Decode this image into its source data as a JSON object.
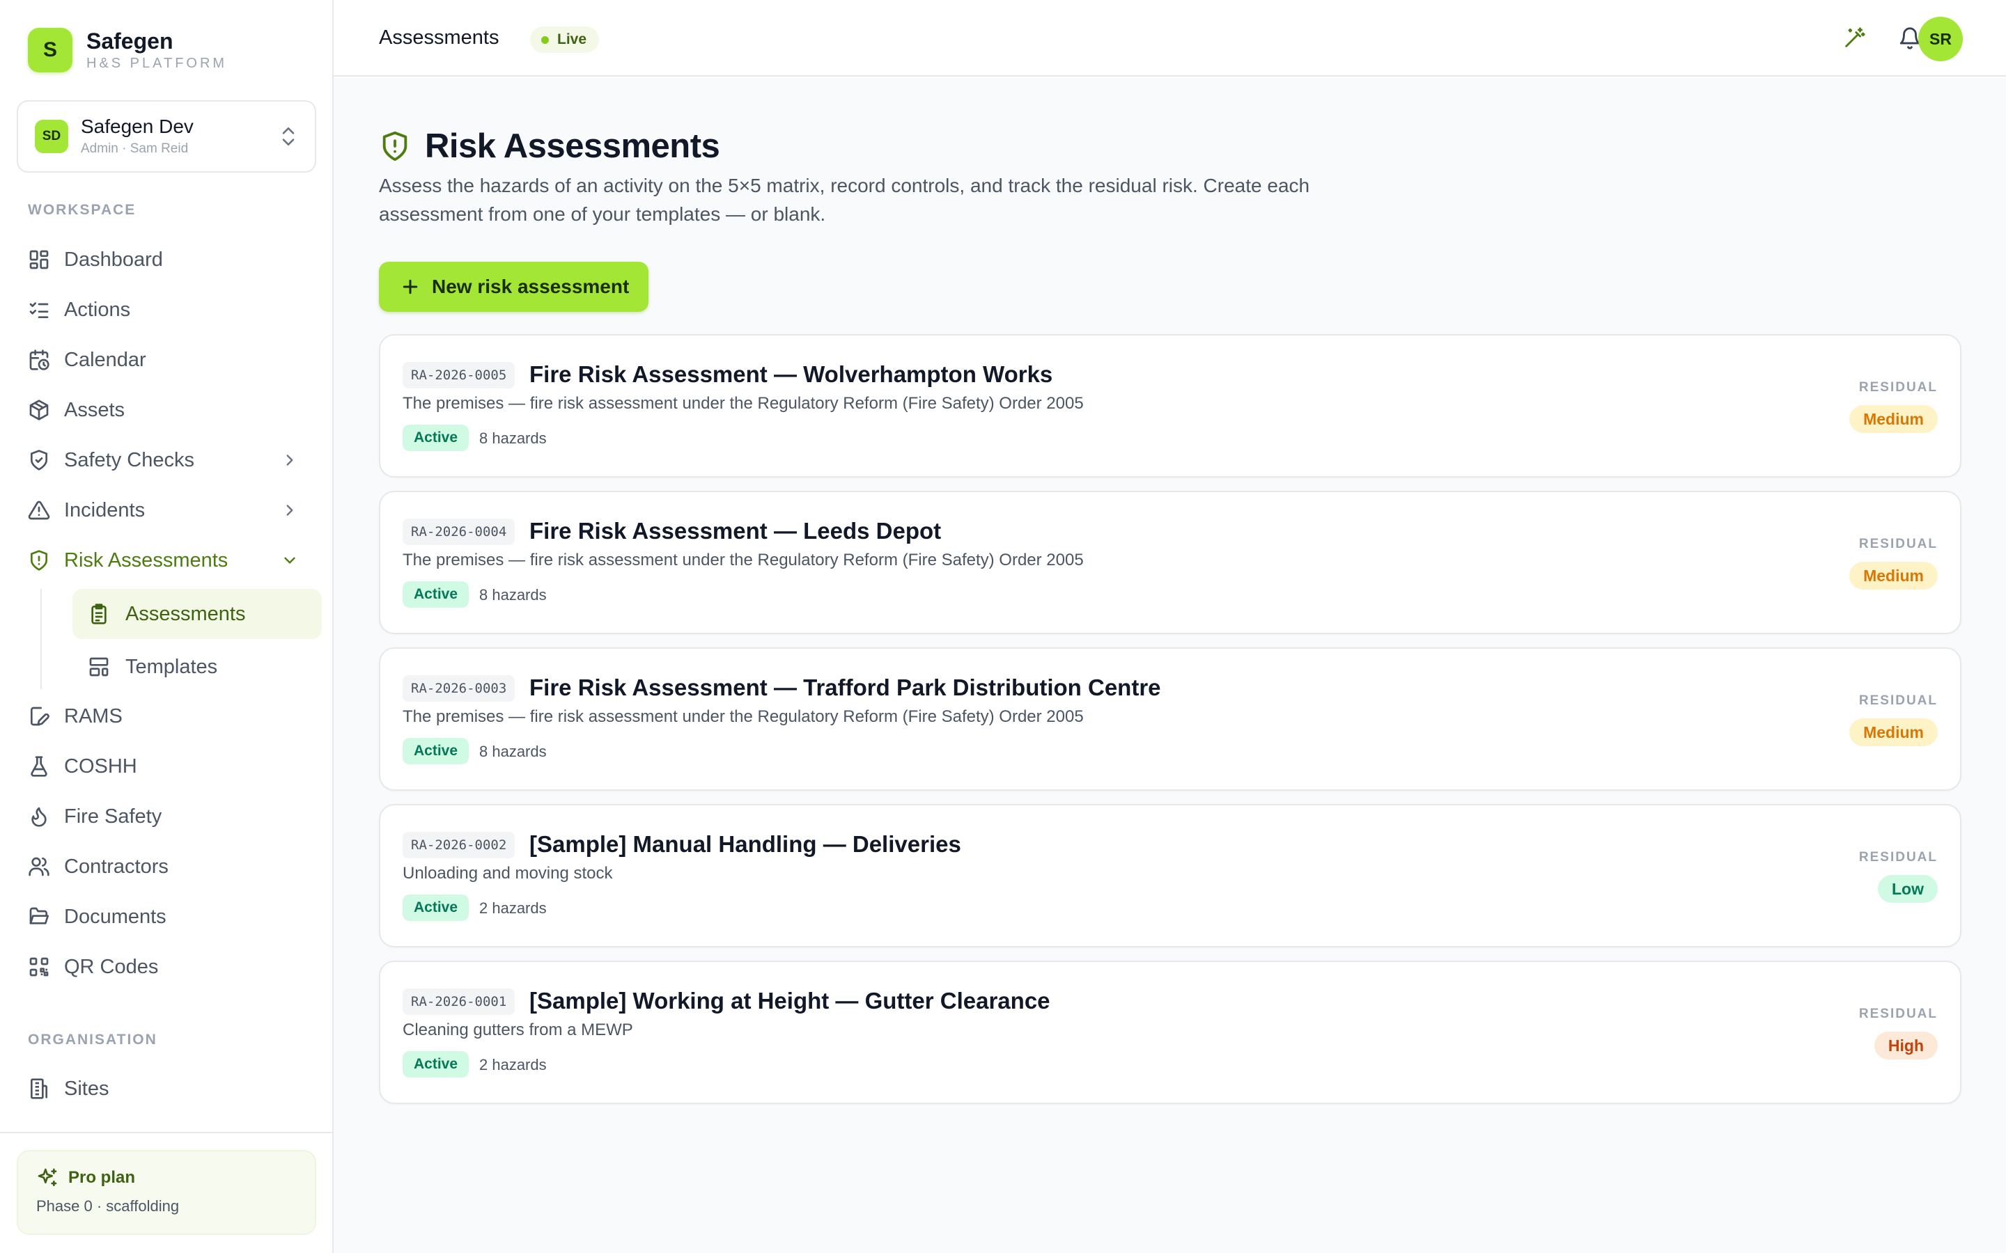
{
  "brand": {
    "logo_letter": "S",
    "name": "Safegen",
    "subtitle": "H&S PLATFORM"
  },
  "org": {
    "initials": "SD",
    "name": "Safegen Dev",
    "meta": "Admin · Sam Reid"
  },
  "sidebar": {
    "workspace_label": "WORKSPACE",
    "organisation_label": "ORGANISATION",
    "items": [
      {
        "label": "Dashboard",
        "icon": "dashboard-icon"
      },
      {
        "label": "Actions",
        "icon": "list-checks-icon"
      },
      {
        "label": "Calendar",
        "icon": "calendar-clock-icon"
      },
      {
        "label": "Assets",
        "icon": "package-icon"
      },
      {
        "label": "Safety Checks",
        "icon": "shield-check-icon"
      },
      {
        "label": "Incidents",
        "icon": "alert-triangle-icon"
      },
      {
        "label": "Risk Assessments",
        "icon": "shield-alert-icon"
      },
      {
        "label": "RAMS",
        "icon": "file-edit-icon"
      },
      {
        "label": "COSHH",
        "icon": "flask-icon"
      },
      {
        "label": "Fire Safety",
        "icon": "flame-icon"
      },
      {
        "label": "Contractors",
        "icon": "users-icon"
      },
      {
        "label": "Documents",
        "icon": "folder-open-icon"
      },
      {
        "label": "QR Codes",
        "icon": "qr-code-icon"
      }
    ],
    "sub_items": [
      {
        "label": "Assessments",
        "icon": "clipboard-list-icon"
      },
      {
        "label": "Templates",
        "icon": "layout-template-icon"
      }
    ],
    "org_items": [
      {
        "label": "Sites",
        "icon": "building-icon"
      }
    ],
    "plan": {
      "title": "Pro plan",
      "subtitle": "Phase 0 · scaffolding"
    }
  },
  "topbar": {
    "title": "Assessments",
    "live_label": "Live",
    "user_initials": "SR"
  },
  "page": {
    "title": "Risk Assessments",
    "description": "Assess the hazards of an activity on the 5×5 matrix, record controls, and track the residual risk. Create each assessment from one of your templates — or blank.",
    "new_button": "New risk assessment",
    "residual_label": "RESIDUAL"
  },
  "assessments": [
    {
      "id": "RA-2026-0005",
      "title": "Fire Risk Assessment — Wolverhampton Works",
      "description": "The premises — fire risk assessment under the Regulatory Reform (Fire Safety) Order 2005",
      "status": "Active",
      "hazards": "8 hazards",
      "residual": "Medium"
    },
    {
      "id": "RA-2026-0004",
      "title": "Fire Risk Assessment — Leeds Depot",
      "description": "The premises — fire risk assessment under the Regulatory Reform (Fire Safety) Order 2005",
      "status": "Active",
      "hazards": "8 hazards",
      "residual": "Medium"
    },
    {
      "id": "RA-2026-0003",
      "title": "Fire Risk Assessment — Trafford Park Distribution Centre",
      "description": "The premises — fire risk assessment under the Regulatory Reform (Fire Safety) Order 2005",
      "status": "Active",
      "hazards": "8 hazards",
      "residual": "Medium"
    },
    {
      "id": "RA-2026-0002",
      "title": "[Sample] Manual Handling — Deliveries",
      "description": "Unloading and moving stock",
      "status": "Active",
      "hazards": "2 hazards",
      "residual": "Low"
    },
    {
      "id": "RA-2026-0001",
      "title": "[Sample] Working at Height — Gutter Clearance",
      "description": "Cleaning gutters from a MEWP",
      "status": "Active",
      "hazards": "2 hazards",
      "residual": "High"
    }
  ],
  "colors": {
    "accent": "#a3e635",
    "accent_dark": "#4d7c0f",
    "medium": "#d97706",
    "low": "#047857",
    "high": "#c2410c"
  }
}
